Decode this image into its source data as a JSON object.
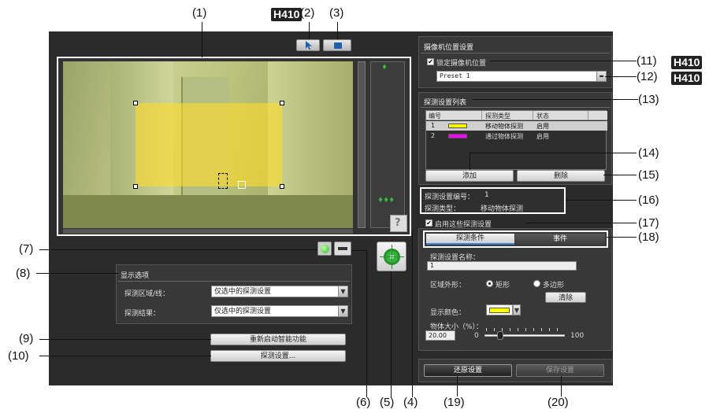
{
  "callouts": {
    "c1": "(1)",
    "c2": "(2)",
    "c3": "(3)",
    "c4": "(4)",
    "c5": "(5)",
    "c6": "(6)",
    "c7": "(7)",
    "c8": "(8)",
    "c9": "(9)",
    "c10": "(10)",
    "c11": "(11)",
    "c12": "(12)",
    "c13": "(13)",
    "c14": "(14)",
    "c15": "(15)",
    "c16": "(16)",
    "c17": "(17)",
    "c18": "(18)",
    "c19": "(19)",
    "c20": "(20)",
    "badge": "H410"
  },
  "camera_position": {
    "title": "摄像机位置设置",
    "lock_label": "锁定摄像机位置",
    "lock_checked": "✔",
    "preset_value": "Preset 1"
  },
  "detection_list": {
    "title": "探测设置列表",
    "headers": [
      "编号",
      "探测类型",
      "状态"
    ],
    "rows": [
      {
        "num": "1",
        "color": "#ffff00",
        "type": "移动物体探测",
        "status": "启用"
      },
      {
        "num": "2",
        "color": "#ff00ff",
        "type": "通过物体探测",
        "status": "启用"
      }
    ],
    "add_label": "添加",
    "delete_label": "删除"
  },
  "info": {
    "number_label": "探测设置编号：",
    "number_value": "1",
    "type_label": "探测类型：",
    "type_value": "移动物体探测"
  },
  "enable": {
    "label": "启用这些探测设置",
    "checked": "✔"
  },
  "tabs": {
    "conditions": "探测条件",
    "events": "事件"
  },
  "conditions": {
    "name_label": "探测设置名称：",
    "name_value": "1",
    "shape_label": "区域外形：",
    "shape_rect": "矩形",
    "shape_poly": "多边形",
    "clear_label": "清除",
    "color_label": "显示颜色：",
    "color_value": "#ffff00",
    "size_label": "物体大小（%）：",
    "size_value": "20.00",
    "size_min": "0",
    "size_max": "100",
    "size_fraction": 0.2
  },
  "display_options": {
    "title": "显示选项",
    "area_label": "探测区域/线：",
    "area_value": "仅选中的探测设置",
    "result_label": "探测结果：",
    "result_value": "仅选中的探测设置"
  },
  "buttons": {
    "restart": "重新启动智能功能",
    "detect_settings": "探测设置...",
    "restore": "还原设置",
    "save": "保存设置"
  },
  "colors": {
    "accent_green": "#35b53c",
    "highlight": "#ffff00",
    "magenta": "#ff00ff"
  }
}
